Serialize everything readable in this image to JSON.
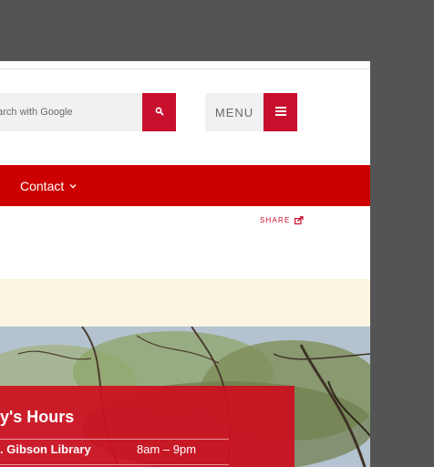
{
  "header": {
    "search": {
      "placeholder": "earch with Google",
      "button_icon": "search-icon"
    },
    "menu": {
      "label": "MENU",
      "icon": "hamburger-icon"
    }
  },
  "nav": {
    "items": [
      {
        "label": "Contact",
        "icon": "chevron-down-icon"
      }
    ]
  },
  "share": {
    "label": "SHARE",
    "icon": "share-icon"
  },
  "colors": {
    "brand_red": "#cc0000",
    "notice_bg": "#fbf5e2",
    "backdrop": "#545454"
  },
  "hours_panel": {
    "title": "y's Hours",
    "rows": [
      {
        "location": ". Gibson Library",
        "hours": "8am – 9pm"
      }
    ]
  }
}
